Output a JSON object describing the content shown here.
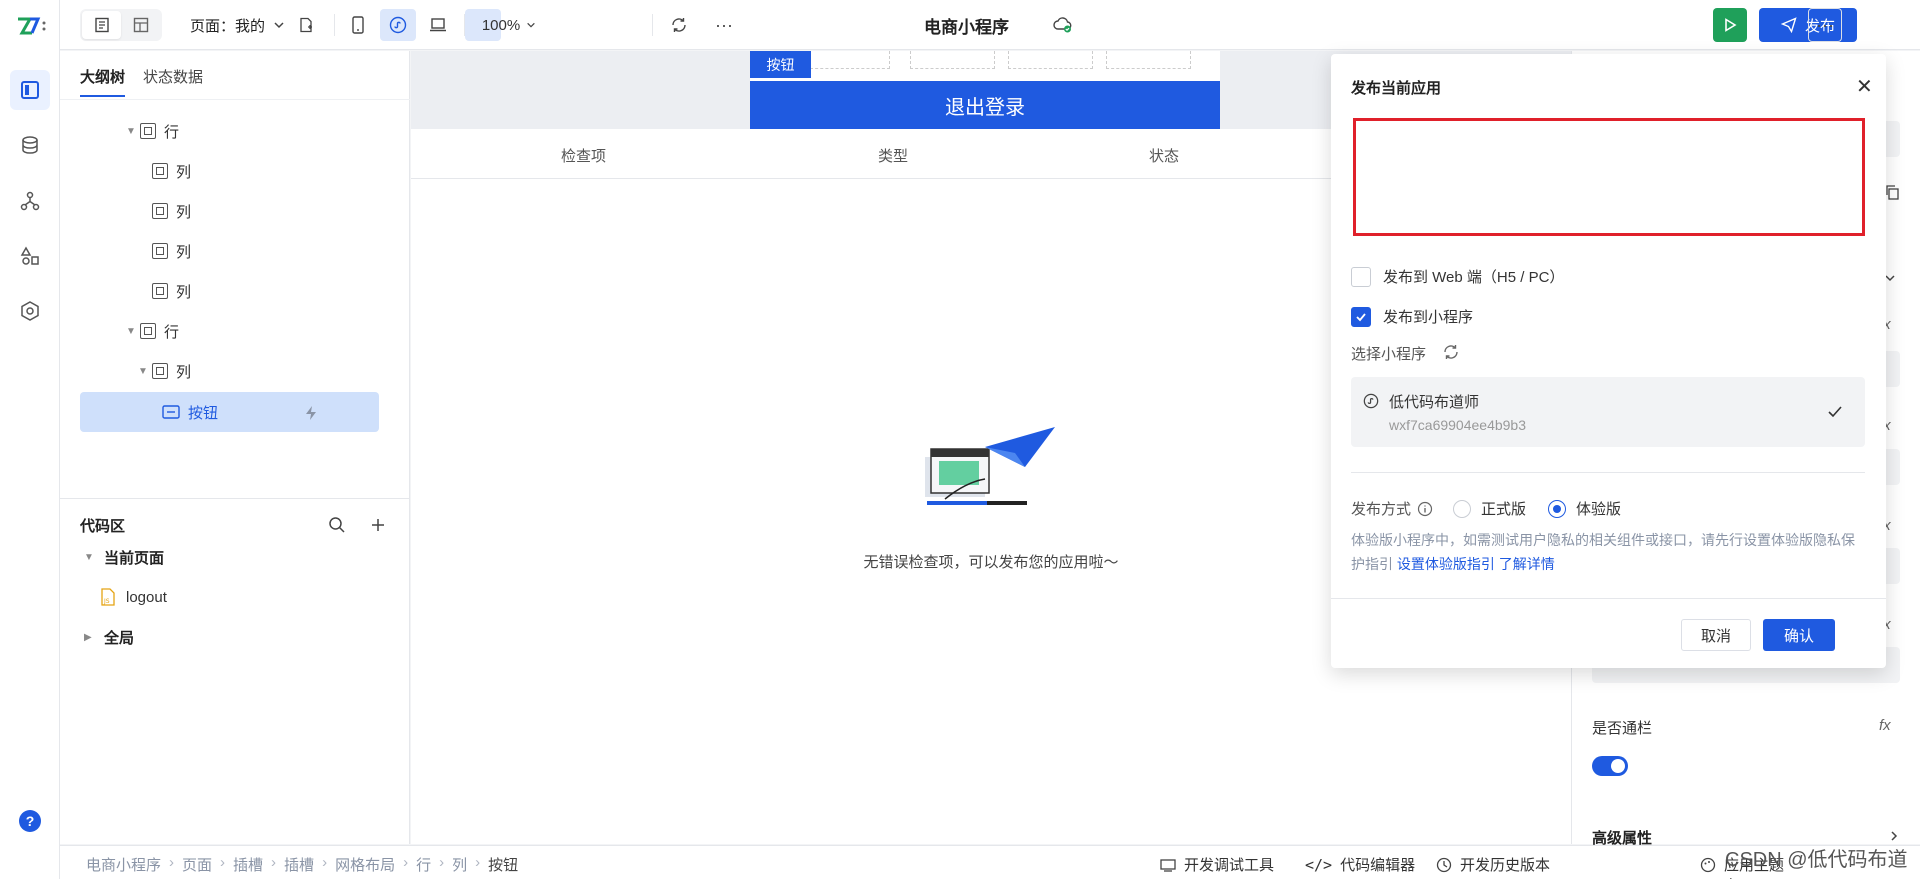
{
  "topbar": {
    "page_select": "页面：我的",
    "zoom": "100%",
    "app_title": "电商小程序",
    "publish_label": "发布"
  },
  "outline": {
    "tabs": [
      "大纲树",
      "状态数据"
    ],
    "tree": [
      {
        "label": "行",
        "caret": true
      },
      {
        "label": "列",
        "caret": false
      },
      {
        "label": "列",
        "caret": false
      },
      {
        "label": "列",
        "caret": false
      },
      {
        "label": "列",
        "caret": false
      },
      {
        "label": "行",
        "caret": true
      },
      {
        "label": "列",
        "caret": true
      },
      {
        "label": "按钮",
        "caret": false,
        "selected": true
      }
    ]
  },
  "code_area": {
    "title": "代码区",
    "current_page": "当前页面",
    "file": "logout",
    "global": "全局"
  },
  "canvas": {
    "button_tag": "按钮",
    "logout_button": "退出登录",
    "columns": [
      "检查项",
      "类型",
      "状态"
    ],
    "empty_text": "无错误检查项，可以发布您的应用啦～"
  },
  "properties": {
    "partial_id": "n1",
    "full_width_label": "是否通栏",
    "advanced_label": "高级属性",
    "fx": "fx",
    "full_width_on": true
  },
  "dialog": {
    "title": "发布当前应用",
    "web_option": "发布到 Web 端（H5 / PC）",
    "web_checked": false,
    "mp_option": "发布到小程序",
    "mp_checked": true,
    "select_label": "选择小程序",
    "mp_name": "低代码布道师",
    "mp_id": "wxf7ca69904ee4b9b3",
    "method_label": "发布方式",
    "method_formal": "正式版",
    "method_trial": "体验版",
    "method_selected": "体验版",
    "note_text": "体验版小程序中，如需测试用户隐私的相关组件或接口，请先行设置体验版隐私保护指引",
    "note_link1": "设置体验版指引",
    "note_link2": "了解详情",
    "cancel": "取消",
    "confirm": "确认"
  },
  "bottombar": {
    "breadcrumbs": [
      "电商小程序",
      "页面",
      "插槽",
      "插槽",
      "网格布局",
      "行",
      "列",
      "按钮"
    ],
    "dev_tools": "开发调试工具",
    "code_editor": "代码编辑器",
    "history": "开发历史版本",
    "apply_theme": "应用主题"
  },
  "watermark": "CSDN @低代码布道师",
  "colors": {
    "accent": "#1f5ae0",
    "run": "#1fa05a",
    "highlight_border": "#e0202a",
    "selected_row": "#cfe0fb"
  }
}
